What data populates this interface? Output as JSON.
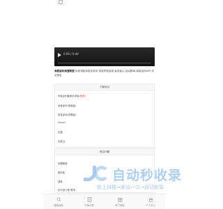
{
  "video": {
    "time": "0:00 / 0:44",
    "progress": 0
  },
  "description": {
    "title": "淘客返利淘宝联盟",
    "text": "免费领取淘宝优惠券,淘宝购物返现,省钱省心,自动跟单,淘客返利APP,安全稳定"
  },
  "download": {
    "header": "下载地址",
    "items": [
      {
        "text": "淘宝返利最新安卓版",
        "highlight": "(推荐)"
      },
      {
        "text": "淘宝返利(电脑版)",
        "highlight": ""
      },
      {
        "text": "淘宝返利(苹果版)",
        "highlight": ""
      },
      {
        "text": "Steam",
        "highlight": ""
      },
      {
        "text": "迅雷",
        "highlight": ""
      },
      {
        "text": "百度云",
        "highlight": ""
      }
    ]
  },
  "faq": {
    "header": "常见问题",
    "items": [
      "查看教程",
      "服务费",
      "退款",
      "找不到订单?联系"
    ]
  },
  "watermark": {
    "main": "自动秒收录",
    "sub": "数上排楼→来访一次→自动收录"
  },
  "tabbar": {
    "items": [
      {
        "icon": "search-icon",
        "label": "搜索商品"
      },
      {
        "icon": "list-icon",
        "label": "订单记录"
      },
      {
        "icon": "gift-icon",
        "label": "热门商品"
      },
      {
        "icon": "home-icon",
        "label": "个人中心"
      }
    ]
  }
}
